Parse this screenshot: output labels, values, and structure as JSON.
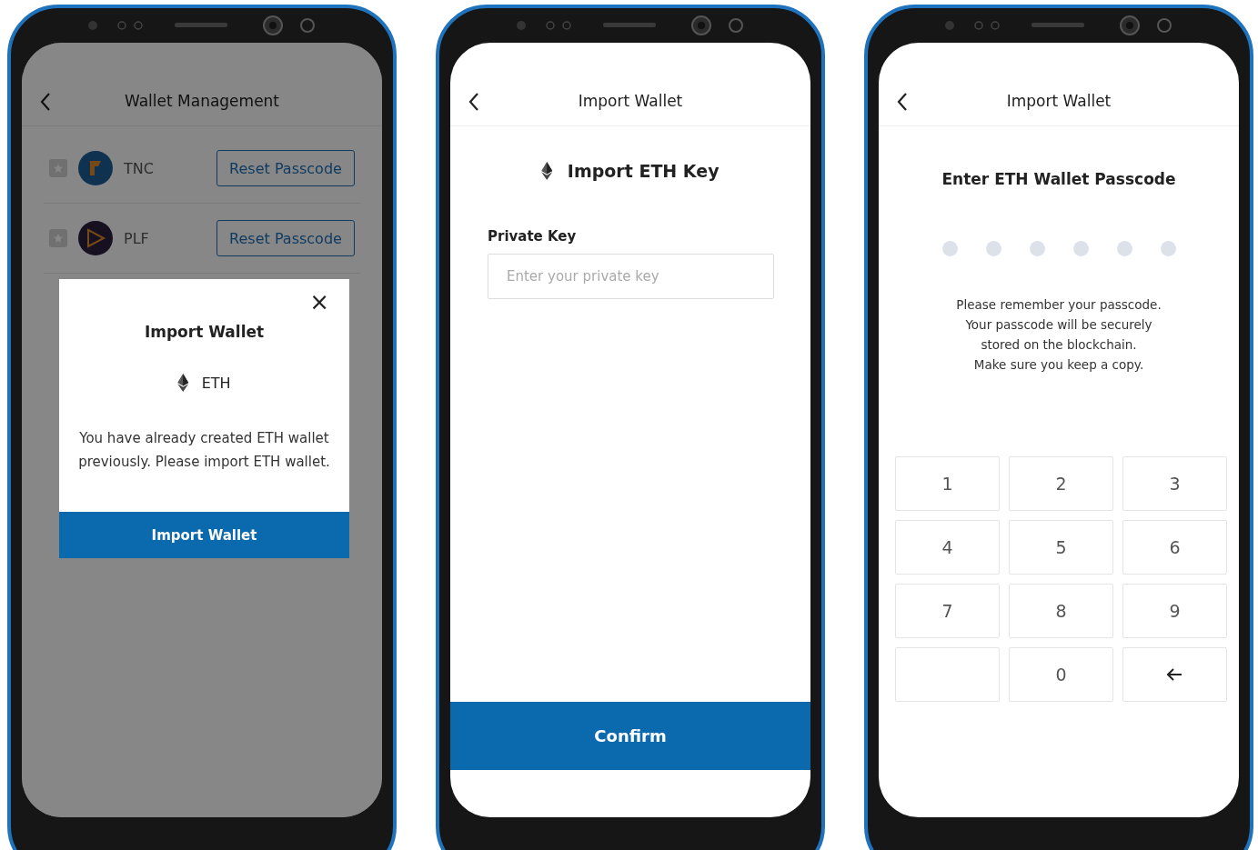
{
  "phones": [
    {
      "kind": "wallet_management",
      "header": {
        "title": "Wallet Management"
      },
      "wallets": [
        {
          "name": "TNC",
          "kind": "tnc",
          "favorite": false,
          "action": "Reset Passcode"
        },
        {
          "name": "PLF",
          "kind": "plf",
          "favorite": false,
          "action": "Reset Passcode"
        }
      ],
      "dialog": {
        "title": "Import Wallet",
        "coin": "ETH",
        "message": "You have already created ETH wallet previously. Please import ETH wallet.",
        "close": "×",
        "button": "Import Wallet"
      }
    },
    {
      "kind": "import_key",
      "header": {
        "title": "Import Wallet"
      },
      "heading": "Import ETH Key",
      "field_label": "Private Key",
      "placeholder": "Enter your private key",
      "button": "Confirm"
    },
    {
      "kind": "passcode",
      "header": {
        "title": "Import Wallet"
      },
      "heading": "Enter ETH Wallet Passcode",
      "dots": [
        {
          "filled": false
        },
        {
          "filled": false
        },
        {
          "filled": false
        },
        {
          "filled": false
        },
        {
          "filled": false
        },
        {
          "filled": false
        }
      ],
      "notice": [
        "Please remember your passcode.",
        "Your passcode will be securely",
        "stored on the blockchain.",
        "Make sure you keep a copy."
      ],
      "keys": [
        {
          "kind": "digit",
          "label": "1"
        },
        {
          "kind": "digit",
          "label": "2"
        },
        {
          "kind": "digit",
          "label": "3"
        },
        {
          "kind": "digit",
          "label": "4"
        },
        {
          "kind": "digit",
          "label": "5"
        },
        {
          "kind": "digit",
          "label": "6"
        },
        {
          "kind": "digit",
          "label": "7"
        },
        {
          "kind": "digit",
          "label": "8"
        },
        {
          "kind": "digit",
          "label": "9"
        },
        {
          "kind": "blank"
        },
        {
          "kind": "digit",
          "label": "0"
        },
        {
          "kind": "backspace"
        }
      ]
    }
  ]
}
